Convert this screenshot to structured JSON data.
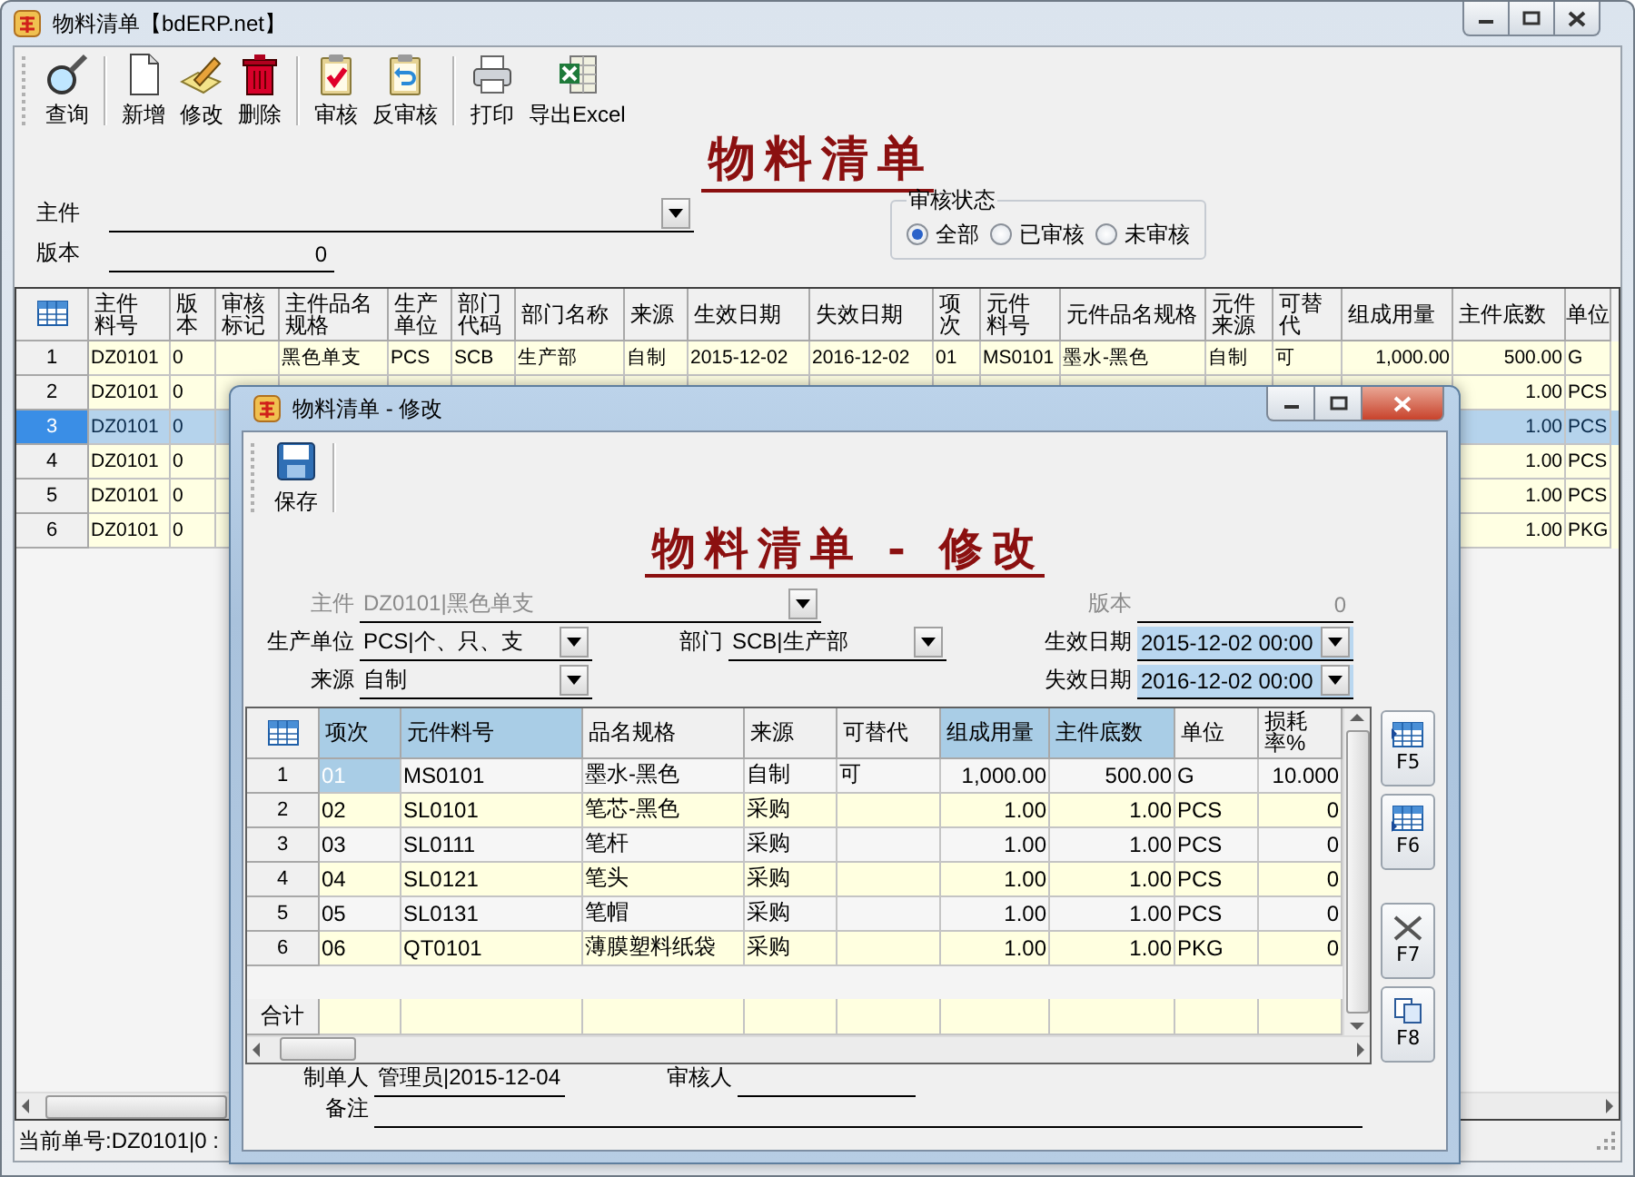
{
  "window": {
    "title": "物料清单【bdERP.net】"
  },
  "toolbar": {
    "groups": [
      {
        "items": [
          {
            "label": "查询"
          }
        ]
      },
      {
        "items": [
          {
            "label": "新增"
          },
          {
            "label": "修改"
          },
          {
            "label": "删除"
          }
        ]
      },
      {
        "items": [
          {
            "label": "审核"
          },
          {
            "label": "反审核"
          }
        ]
      },
      {
        "items": [
          {
            "label": "打印"
          },
          {
            "label": "导出Excel"
          }
        ]
      }
    ]
  },
  "heading": "物料清单",
  "filters": {
    "main_part": {
      "label": "主件",
      "kind": "combo"
    },
    "version": {
      "label": "版本",
      "value": "0",
      "kind": "text"
    },
    "audit_status": {
      "label": "审核状态",
      "options": [
        {
          "label": "全部",
          "selected": true
        },
        {
          "label": "已审核",
          "selected": false
        },
        {
          "label": "未审核",
          "selected": false
        }
      ]
    }
  },
  "table": {
    "columns": [
      "主件料号",
      "版本",
      "审核标记",
      "主件品名规格",
      "生产单位",
      "部门代码",
      "部门名称",
      "来源",
      "生效日期",
      "失效日期",
      "项次",
      "元件料号",
      "元件品名规格",
      "元件来源",
      "可替代",
      "组成用量",
      "主件底数",
      "单位"
    ],
    "rows": [
      {
        "no": "1",
        "main_code": "DZ0101",
        "version": "0",
        "main_spec": "黑色单支",
        "prod_unit": "PCS",
        "dept_code": "SCB",
        "dept_name": "生产部",
        "source": "自制",
        "eff_date": "2015-12-02",
        "exp_date": "2016-12-02",
        "item_no": "01",
        "part_code": "MS0101",
        "part_spec": "墨水-黑色",
        "part_source": "自制",
        "substitutable": "可",
        "qty": "1,000.00",
        "base_qty": "500.00",
        "unit": "G",
        "selected": false
      },
      {
        "no": "2",
        "main_code": "DZ0101",
        "version": "0",
        "base_qty": "1.00",
        "unit": "PCS",
        "selected": false
      },
      {
        "no": "3",
        "main_code": "DZ0101",
        "version": "0",
        "base_qty": "1.00",
        "unit": "PCS",
        "selected": true
      },
      {
        "no": "4",
        "main_code": "DZ0101",
        "version": "0",
        "base_qty": "1.00",
        "unit": "PCS",
        "selected": false
      },
      {
        "no": "5",
        "main_code": "DZ0101",
        "version": "0",
        "base_qty": "1.00",
        "unit": "PCS",
        "selected": false
      },
      {
        "no": "6",
        "main_code": "DZ0101",
        "version": "0",
        "base_qty": "1.00",
        "unit": "PKG",
        "selected": false
      }
    ]
  },
  "status_bar": "当前单号:DZ0101|0 :",
  "dialog": {
    "title": "物料清单 - 修改",
    "toolbar": [
      {
        "label": "保存"
      }
    ],
    "heading": "物料清单 - 修改",
    "fields": {
      "main_part": {
        "label": "主件",
        "value": "DZ0101|黑色单支",
        "kind": "combo",
        "disabled": true
      },
      "version": {
        "label": "版本",
        "value": "0",
        "kind": "text",
        "disabled": true
      },
      "prod_unit": {
        "label": "生产单位",
        "value": "PCS|个、只、支",
        "kind": "combo",
        "disabled": false
      },
      "dept": {
        "label": "部门",
        "value": "SCB|生产部",
        "kind": "combo",
        "disabled": false
      },
      "eff_date": {
        "label": "生效日期",
        "value": "2015-12-02 00:00",
        "kind": "date",
        "disabled": false
      },
      "source": {
        "label": "来源",
        "value": "自制",
        "kind": "combo",
        "disabled": false
      },
      "exp_date": {
        "label": "失效日期",
        "value": "2016-12-02 00:00",
        "kind": "date",
        "disabled": false
      }
    },
    "grid": {
      "columns": [
        {
          "label": "项次",
          "highlighted": true
        },
        {
          "label": "元件料号",
          "highlighted": true
        },
        {
          "label": "品名规格",
          "highlighted": false
        },
        {
          "label": "来源",
          "highlighted": false
        },
        {
          "label": "可替代",
          "highlighted": false
        },
        {
          "label": "组成用量",
          "highlighted": true
        },
        {
          "label": "主件底数",
          "highlighted": true
        },
        {
          "label": "单位",
          "highlighted": false
        },
        {
          "label": "损耗率%",
          "highlighted": false
        }
      ],
      "rows": [
        {
          "no": "1",
          "cells": [
            "01",
            "MS0101",
            "墨水-黑色",
            "自制",
            "可",
            "1,000.00",
            "500.00",
            "G",
            "10.000"
          ],
          "selected": true
        },
        {
          "no": "2",
          "cells": [
            "02",
            "SL0101",
            "笔芯-黑色",
            "采购",
            "",
            "1.00",
            "1.00",
            "PCS",
            "0"
          ],
          "selected": false
        },
        {
          "no": "3",
          "cells": [
            "03",
            "SL0111",
            "笔杆",
            "采购",
            "",
            "1.00",
            "1.00",
            "PCS",
            "0"
          ],
          "selected": false
        },
        {
          "no": "4",
          "cells": [
            "04",
            "SL0121",
            "笔头",
            "采购",
            "",
            "1.00",
            "1.00",
            "PCS",
            "0"
          ],
          "selected": false
        },
        {
          "no": "5",
          "cells": [
            "05",
            "SL0131",
            "笔帽",
            "采购",
            "",
            "1.00",
            "1.00",
            "PCS",
            "0"
          ],
          "selected": false
        },
        {
          "no": "6",
          "cells": [
            "06",
            "QT0101",
            "薄膜塑料纸袋",
            "采购",
            "",
            "1.00",
            "1.00",
            "PKG",
            "0"
          ],
          "selected": false
        }
      ],
      "total_label": "合计"
    },
    "side_buttons": [
      {
        "label": "F5"
      },
      {
        "label": "F6"
      },
      {
        "label": "F7"
      },
      {
        "label": "F8"
      }
    ],
    "footer": {
      "creator": {
        "label": "制单人",
        "value": "管理员|2015-12-04"
      },
      "auditor": {
        "label": "审核人"
      },
      "note": {
        "label": "备注"
      }
    }
  }
}
